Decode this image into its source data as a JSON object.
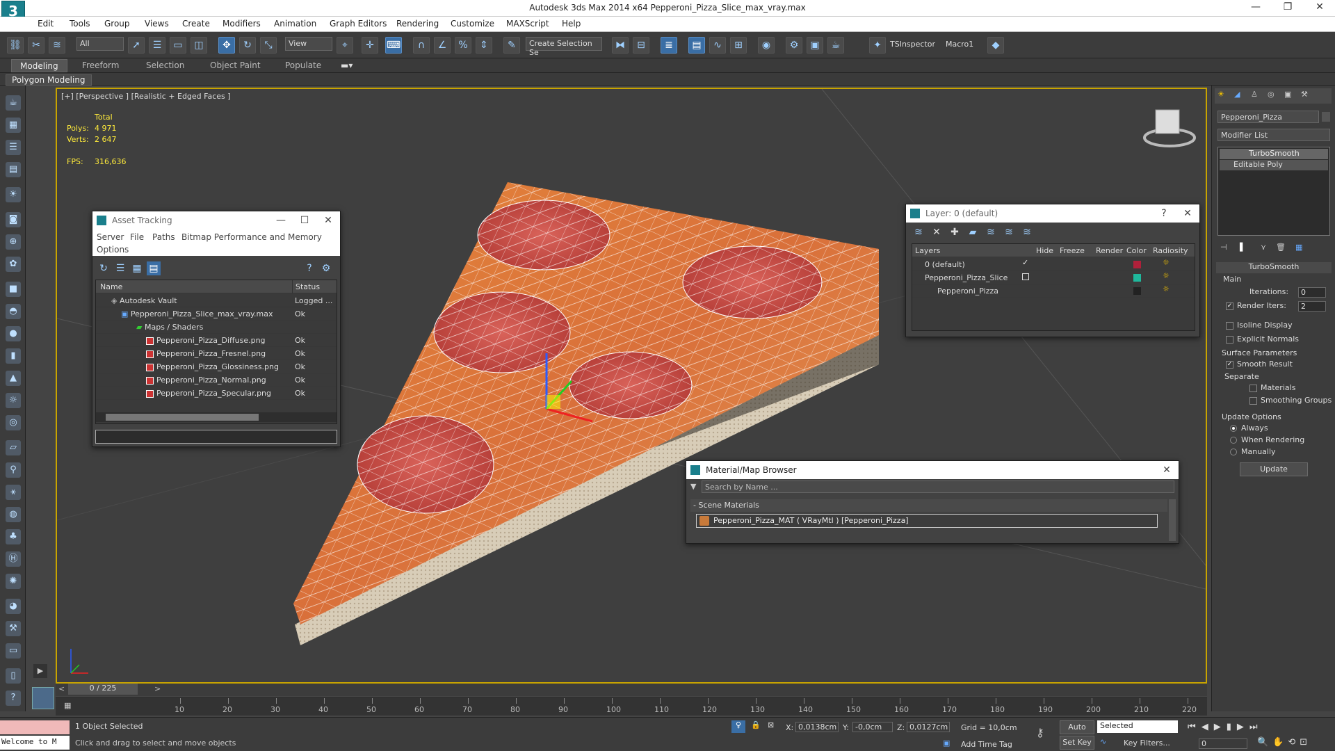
{
  "app": {
    "title": "Autodesk 3ds Max  2014 x64     Pepperoni_Pizza_Slice_max_vray.max",
    "logo": "3",
    "window_controls": [
      "—",
      "❐",
      "✕"
    ]
  },
  "menu": [
    "Edit",
    "Tools",
    "Group",
    "Views",
    "Create",
    "Modifiers",
    "Animation",
    "Graph Editors",
    "Rendering",
    "Customize",
    "MAXScript",
    "Help"
  ],
  "toolbar": {
    "filter_value": "All",
    "coord_value": "View",
    "selection_set": "Create Selection Se",
    "percent_snap": "%",
    "ts_inspector": "TSInspector",
    "macro": "Macro1"
  },
  "ribbon": {
    "tabs": [
      "Modeling",
      "Freeform",
      "Selection",
      "Object Paint",
      "Populate"
    ],
    "active_tab": "Modeling",
    "sub_panel": "Polygon Modeling"
  },
  "viewport": {
    "label": "[+] [Perspective ] [Realistic + Edged Faces ]",
    "stats_header": "Total",
    "polys_label": "Polys:",
    "polys_value": "4 971",
    "verts_label": "Verts:",
    "verts_value": "2 647",
    "fps_label": "FPS:",
    "fps_value": "316,636"
  },
  "asset_tracking": {
    "title": "Asset Tracking",
    "menu": [
      "Server",
      "File",
      "Paths",
      "Bitmap Performance and Memory"
    ],
    "menu2": "Options",
    "columns": [
      "Name",
      "Status"
    ],
    "rows": [
      {
        "name": "Autodesk Vault",
        "status": "Logged ..."
      },
      {
        "name": "Pepperoni_Pizza_Slice_max_vray.max",
        "status": "Ok"
      },
      {
        "name": "Maps / Shaders",
        "status": ""
      },
      {
        "name": "Pepperoni_Pizza_Diffuse.png",
        "status": "Ok"
      },
      {
        "name": "Pepperoni_Pizza_Fresnel.png",
        "status": "Ok"
      },
      {
        "name": "Pepperoni_Pizza_Glossiness.png",
        "status": "Ok"
      },
      {
        "name": "Pepperoni_Pizza_Normal.png",
        "status": "Ok"
      },
      {
        "name": "Pepperoni_Pizza_Specular.png",
        "status": "Ok"
      }
    ]
  },
  "layer_dialog": {
    "title": "Layer: 0 (default)",
    "help": "?",
    "columns": [
      "Layers",
      "Hide",
      "Freeze",
      "Render",
      "Color",
      "Radiosity"
    ],
    "rows": [
      {
        "name": "0 (default)",
        "color": "#b0203a"
      },
      {
        "name": "Pepperoni_Pizza_Slice",
        "color": "#1fb89c"
      },
      {
        "name": "Pepperoni_Pizza",
        "color": "#222222"
      }
    ]
  },
  "material_browser": {
    "title": "Material/Map Browser",
    "search_placeholder": "Search by Name ...",
    "section": "- Scene Materials",
    "item": "Pepperoni_Pizza_MAT ( VRayMtl ) [Pepperoni_Pizza]"
  },
  "command_panel": {
    "object_name": "Pepperoni_Pizza",
    "modifier_list": "Modifier List",
    "stack": [
      "TurboSmooth",
      "Editable Poly"
    ],
    "rollout_title": "TurboSmooth",
    "main_label": "Main",
    "iterations_label": "Iterations:",
    "iterations_value": "0",
    "render_iters_label": "Render Iters:",
    "render_iters_value": "2",
    "isoline": "Isoline Display",
    "explicit_normals": "Explicit Normals",
    "surface_params": "Surface Parameters",
    "smooth_result": "Smooth Result",
    "separate": "Separate",
    "materials": "Materials",
    "smoothing_groups": "Smoothing Groups",
    "update_options": "Update Options",
    "always": "Always",
    "when_rendering": "When Rendering",
    "manually": "Manually",
    "update_button": "Update"
  },
  "timeline": {
    "frame": "0 / 225",
    "ticks": [
      "10",
      "20",
      "30",
      "40",
      "50",
      "60",
      "70",
      "80",
      "90",
      "100",
      "110",
      "120",
      "130",
      "140",
      "150",
      "160",
      "170",
      "180",
      "190",
      "200",
      "210",
      "220"
    ]
  },
  "status": {
    "maxscript": "Welcome to M",
    "selected": "1 Object Selected",
    "prompt": "Click and drag to select and move objects",
    "x_label": "X:",
    "x_value": "0,0138cm",
    "y_label": "Y:",
    "y_value": "-0,0cm",
    "z_label": "Z:",
    "z_value": "0,0127cm",
    "grid": "Grid = 10,0cm",
    "add_time_tag": "Add Time Tag",
    "auto_key": "Auto Key",
    "set_key": "Set Key",
    "key_mode": "Selected",
    "key_filters": "Key Filters...",
    "frame_value": "0"
  }
}
